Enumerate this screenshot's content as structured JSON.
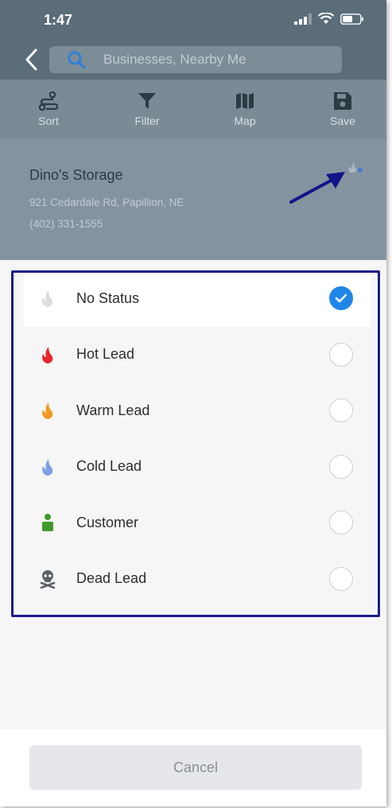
{
  "status_bar": {
    "time": "1:47"
  },
  "search": {
    "placeholder": "Businesses, Nearby Me"
  },
  "toolbar": {
    "sort_label": "Sort",
    "filter_label": "Filter",
    "map_label": "Map",
    "save_label": "Save"
  },
  "listing": {
    "name": "Dino's Storage",
    "address": "921 Cedardale Rd, Papillion, NE",
    "phone": "(402) 331-1555"
  },
  "status_options": [
    {
      "label": "No Status",
      "icon": "flame-icon",
      "color": "#dcdcdc",
      "selected": true
    },
    {
      "label": "Hot Lead",
      "icon": "flame-icon",
      "color": "#e8262b",
      "selected": false
    },
    {
      "label": "Warm Lead",
      "icon": "flame-icon",
      "color": "#f39a24",
      "selected": false
    },
    {
      "label": "Cold Lead",
      "icon": "flame-icon",
      "color": "#7f9ee6",
      "selected": false
    },
    {
      "label": "Customer",
      "icon": "person-icon",
      "color": "#3e9b2a",
      "selected": false
    },
    {
      "label": "Dead Lead",
      "icon": "skull-crossbones-icon",
      "color": "#5b6166",
      "selected": false
    }
  ],
  "cancel_label": "Cancel",
  "colors": {
    "header": "#5a6d79",
    "accent": "#1f86e8",
    "highlight_border": "#1c1c8a"
  }
}
